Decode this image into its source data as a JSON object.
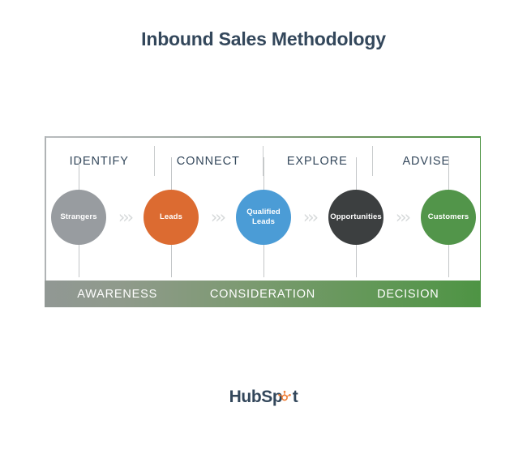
{
  "title": "Inbound Sales Methodology",
  "stages": [
    {
      "label": "IDENTIFY"
    },
    {
      "label": "CONNECT"
    },
    {
      "label": "EXPLORE"
    },
    {
      "label": "ADVISE"
    }
  ],
  "nodes": [
    {
      "label": "Strangers",
      "color": "#989ca0"
    },
    {
      "label": "Leads",
      "color": "#dc6b31"
    },
    {
      "label": "Qualified\nLeads",
      "color": "#4b9cd6"
    },
    {
      "label": "Opportunities",
      "color": "#3c3f40"
    },
    {
      "label": "Customers",
      "color": "#52954a"
    }
  ],
  "arrows": [
    {
      "glyph": "›››"
    },
    {
      "glyph": "›››"
    },
    {
      "glyph": "›››"
    },
    {
      "glyph": "›››"
    }
  ],
  "phases": [
    {
      "label": "AWARENESS"
    },
    {
      "label": "CONSIDERATION"
    },
    {
      "label": "DECISION"
    }
  ],
  "logo": {
    "text_before": "HubSp",
    "text_after": "t",
    "brand_color": "#33475b",
    "accent_color": "#ef7b31"
  },
  "colors": {
    "background": "#ffffff",
    "title": "#33475b",
    "frame_start": "#b0b3b5",
    "frame_end": "#4e9444",
    "stem": "#c2c5c7",
    "arrow": "#d6d9da",
    "divider": "#c9cccd"
  }
}
